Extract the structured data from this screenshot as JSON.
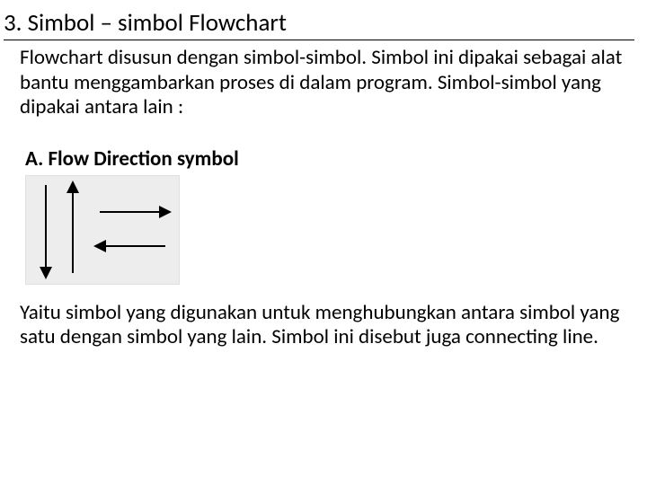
{
  "heading": "3. Simbol – simbol Flowchart",
  "intro_paragraph": "Flowchart disusun dengan simbol-simbol. Simbol ini dipakai sebagai alat bantu menggambarkan proses di dalam program. Simbol-simbol yang dipakai antara lain :",
  "subsection_title": "A. Flow Direction symbol",
  "subsection_paragraph": "Yaitu simbol yang digunakan untuk menghubungkan antara simbol yang satu dengan simbol yang lain. Simbol ini disebut juga connecting line.",
  "figure": {
    "name": "flow-direction-arrows",
    "description": "Four black arrows: down, up, right, left"
  }
}
